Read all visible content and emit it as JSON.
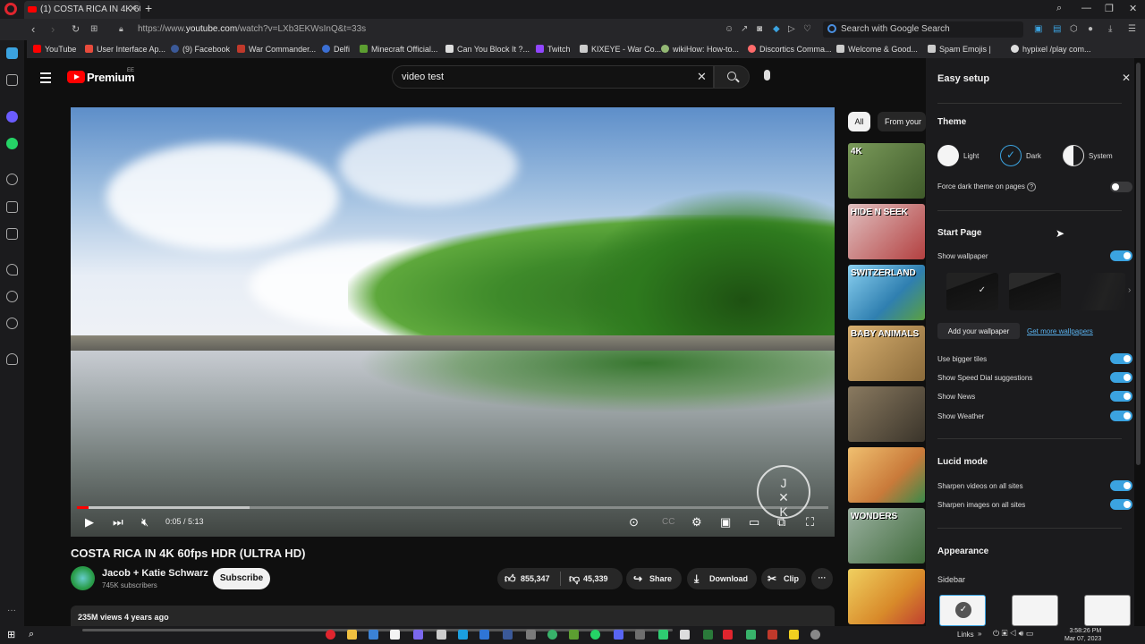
{
  "browser": {
    "tab_title": "(1) COSTA RICA IN 4K 60",
    "url_prefix": "https://www.",
    "url_domain": "youtube.com",
    "url_rest": "/watch?v=LXb3EKWsInQ&t=33s",
    "search_placeholder": "Search with Google Search",
    "bookmarks": [
      {
        "label": "YouTube",
        "color": "#ff0000"
      },
      {
        "label": "User Interface Ap...",
        "color": "#e84b3c"
      },
      {
        "label": "(9) Facebook",
        "color": "#3b5998"
      },
      {
        "label": "War Commander...",
        "color": "#c0392b"
      },
      {
        "label": "Delfi",
        "color": "#3b6fd4"
      },
      {
        "label": "Minecraft Official...",
        "color": "#5c9e31"
      },
      {
        "label": "Can You Block It ?...",
        "color": "#dddddd"
      },
      {
        "label": "Twitch",
        "color": "#9146ff"
      },
      {
        "label": "KIXEYE - War Co...",
        "color": "#cccccc"
      },
      {
        "label": "wikiHow: How-to...",
        "color": "#93b874"
      },
      {
        "label": "Discortics Comma...",
        "color": "#ff6b6b"
      },
      {
        "label": "Welcome & Good...",
        "color": "#cccccc"
      },
      {
        "label": "Spam Emojis |",
        "color": "#cccccc"
      },
      {
        "label": "hypixel /play com...",
        "color": "#dddddd"
      }
    ]
  },
  "youtube": {
    "brand": "Premium",
    "region": "EE",
    "search_query": "video test",
    "player": {
      "time": "0:05 / 5:13",
      "progress_fraction": 0.016,
      "buffer_fraction": 0.23
    },
    "video_title": "COSTA RICA IN 4K 60fps HDR (ULTRA HD)",
    "channel_name": "Jacob + Katie Schwarz",
    "channel_subs": "745K subscribers",
    "subscribe_label": "Subscribe",
    "likes": "855,347",
    "dislikes": "45,339",
    "share_label": "Share",
    "download_label": "Download",
    "clip_label": "Clip",
    "more_label": "···",
    "views": "235M views  4 years ago",
    "chips": [
      "All",
      "From your"
    ],
    "related": [
      {
        "label": "4K",
        "bg": "#5a7a3a"
      },
      {
        "label": "HIDE N SEEK",
        "bg": "#b34040"
      },
      {
        "label": "SWITZERLAND",
        "bg": "#2f7fb0"
      },
      {
        "label": "BABY ANIMALS",
        "bg": "#8a6a3a"
      },
      {
        "label": "",
        "bg": "#4a4438"
      },
      {
        "label": "",
        "bg": "#c97a3a"
      },
      {
        "label": "WONDERS",
        "bg": "#3f6a3a"
      },
      {
        "label": "",
        "bg": "#d88a2a"
      }
    ]
  },
  "easy_setup": {
    "title": "Easy setup",
    "theme_heading": "Theme",
    "theme_light": "Light",
    "theme_dark": "Dark",
    "theme_system": "System",
    "force_dark": "Force dark theme on pages",
    "start_page_heading": "Start Page",
    "show_wallpaper": "Show wallpaper",
    "add_wallpaper": "Add your wallpaper",
    "get_more_wallpapers": "Get more wallpapers",
    "bigger_tiles": "Use bigger tiles",
    "speed_dial": "Show Speed Dial suggestions",
    "show_news": "Show News",
    "show_weather": "Show Weather",
    "lucid_heading": "Lucid mode",
    "sharpen_videos": "Sharpen videos on all sites",
    "sharpen_images": "Sharpen images on all sites",
    "appearance_heading": "Appearance",
    "sidebar_label": "Sidebar",
    "accent": "#3ba3e0"
  },
  "taskbar": {
    "links_label": "Links",
    "time": "3:58:26 PM",
    "date": "Mar 07, 2023"
  }
}
